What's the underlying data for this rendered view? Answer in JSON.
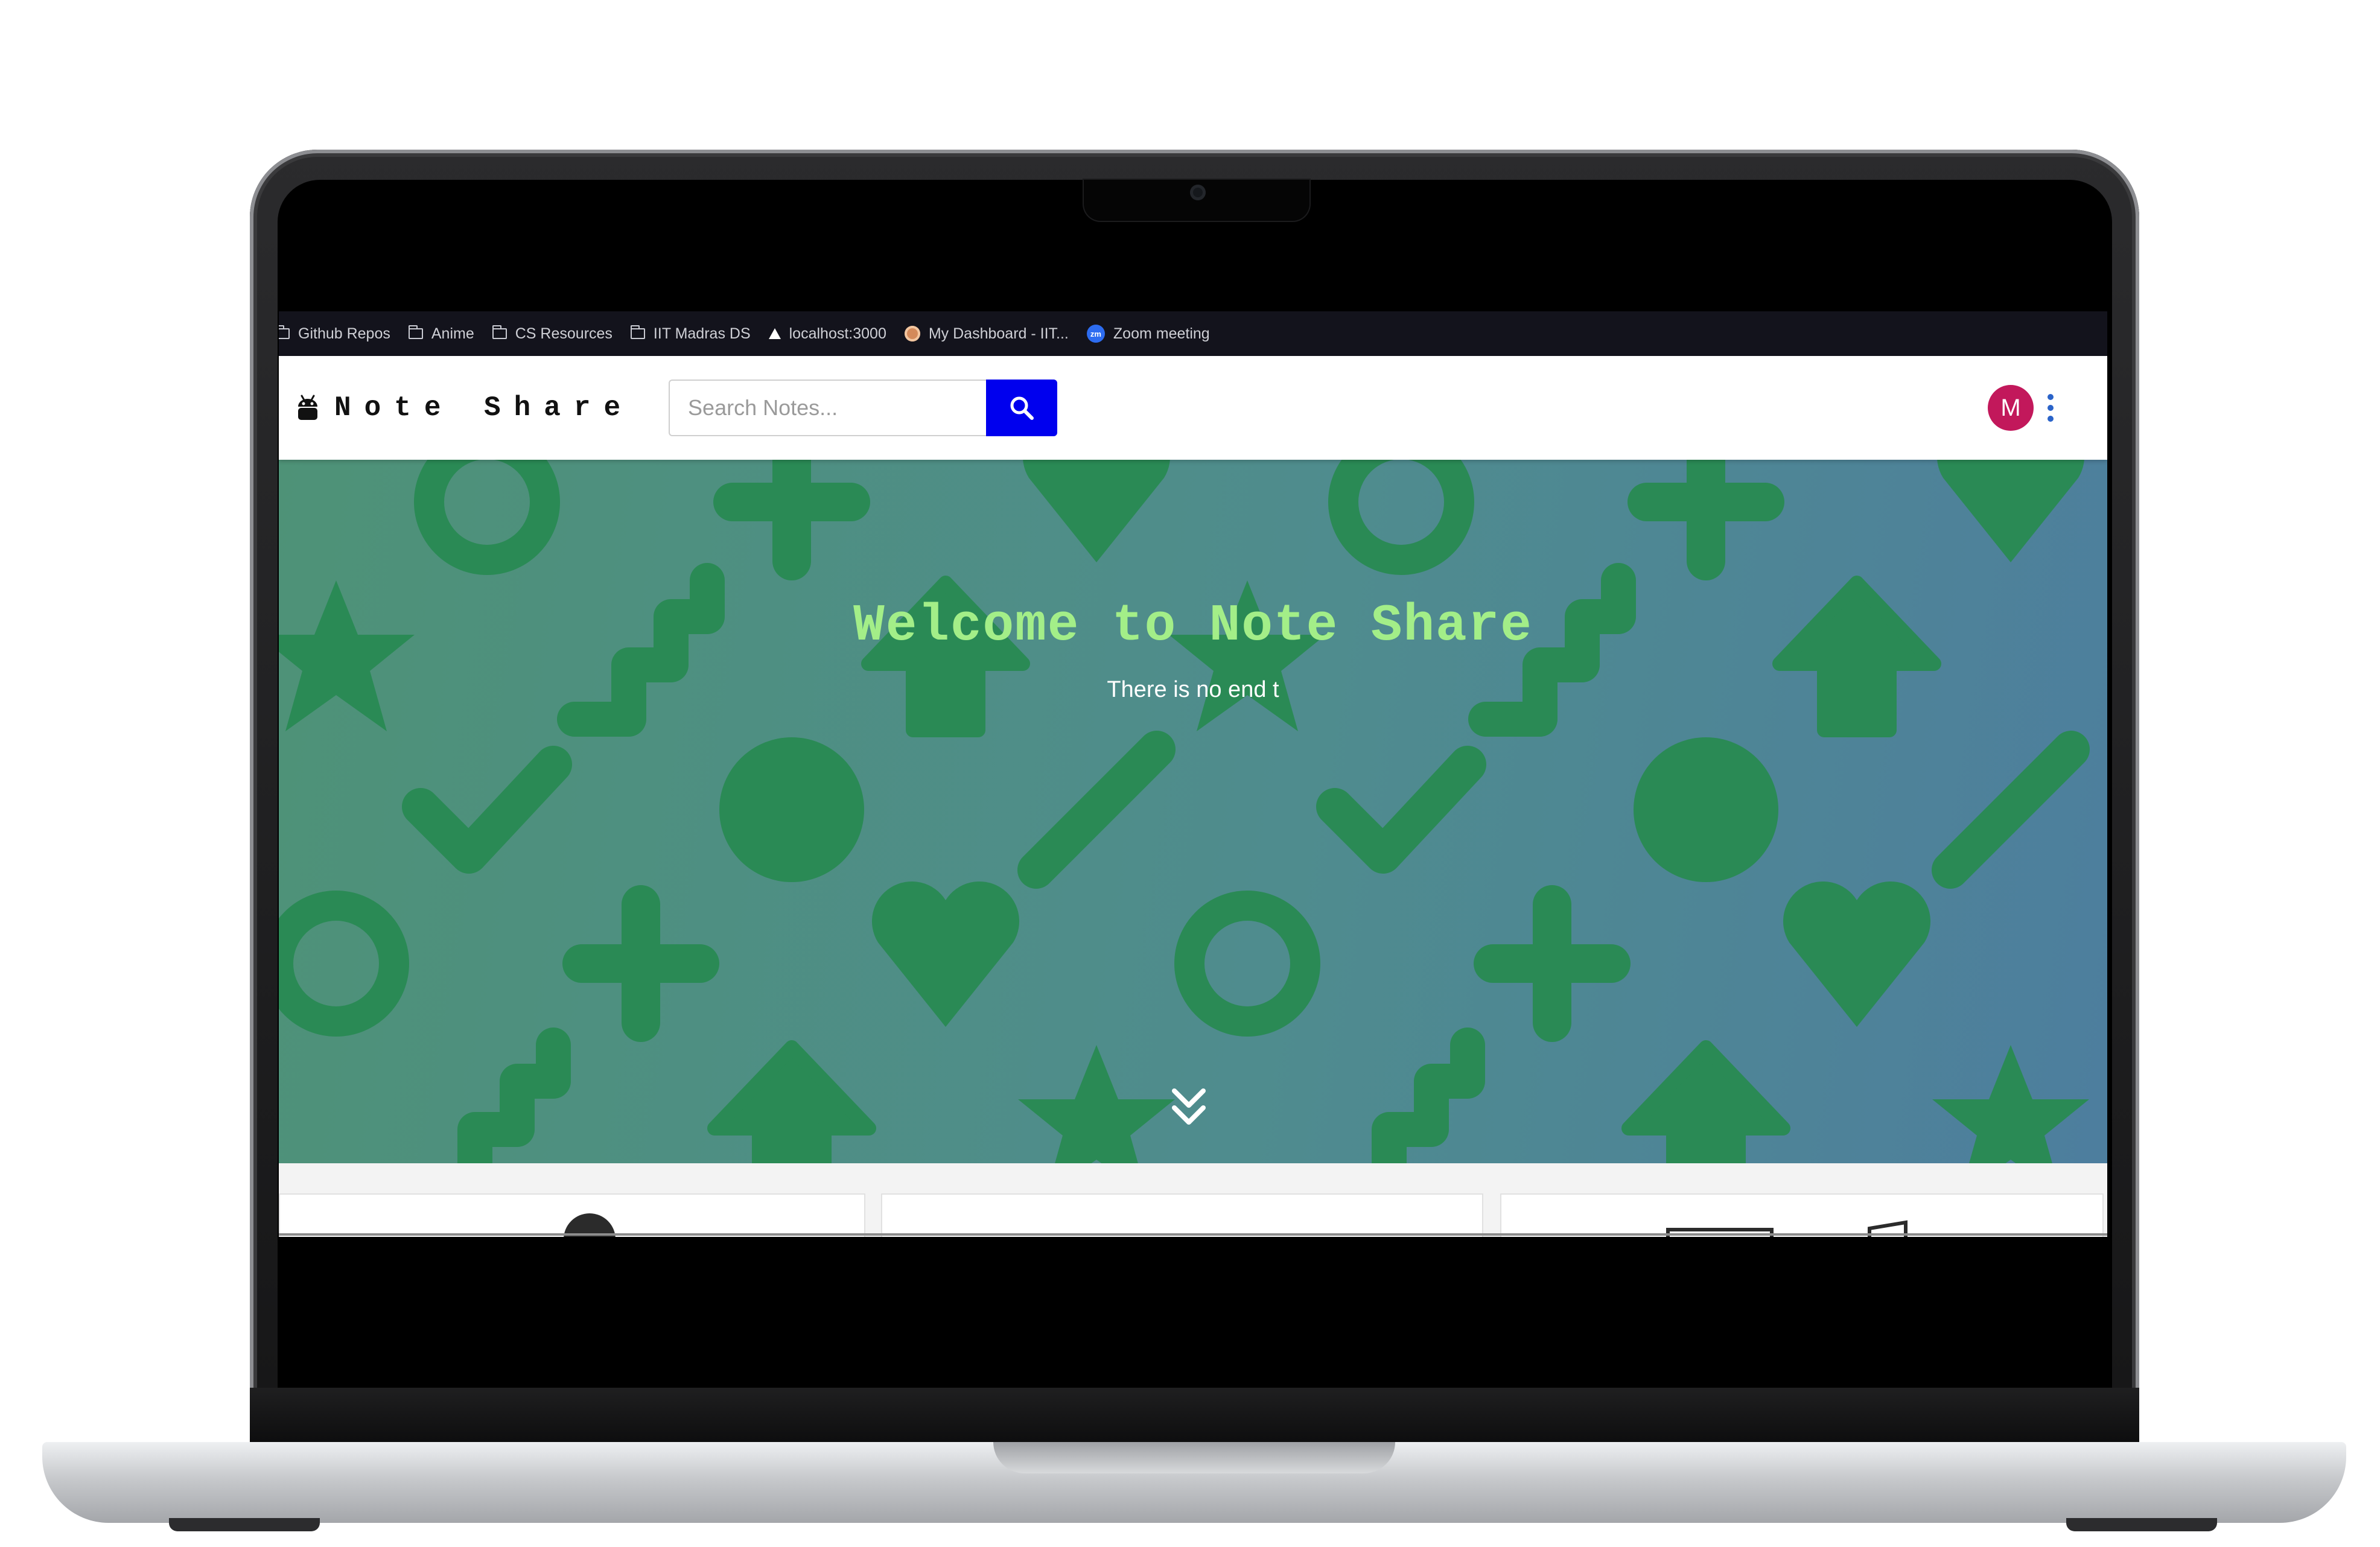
{
  "bookmarks": [
    {
      "label": "Github Repos",
      "icon": "folder-icon"
    },
    {
      "label": "Anime",
      "icon": "folder-icon"
    },
    {
      "label": "CS Resources",
      "icon": "folder-icon"
    },
    {
      "label": "IIT Madras DS",
      "icon": "folder-icon"
    },
    {
      "label": "localhost:3000",
      "icon": "triangle-icon"
    },
    {
      "label": "My Dashboard - IIT...",
      "icon": "dashboard-favicon-icon"
    },
    {
      "label": "Zoom meeting",
      "icon": "zoom-icon",
      "icon_text": "zm"
    }
  ],
  "navbar": {
    "brand": "Note Share",
    "search_placeholder": "Search Notes...",
    "avatar_letter": "M",
    "avatar_color": "#c2185b",
    "search_button_color": "#0000ee"
  },
  "hero": {
    "title": "Welcome to Note Share",
    "subtitle": "There is no end t",
    "title_color": "#a3ee88",
    "shape_color": "#2a8a55"
  }
}
